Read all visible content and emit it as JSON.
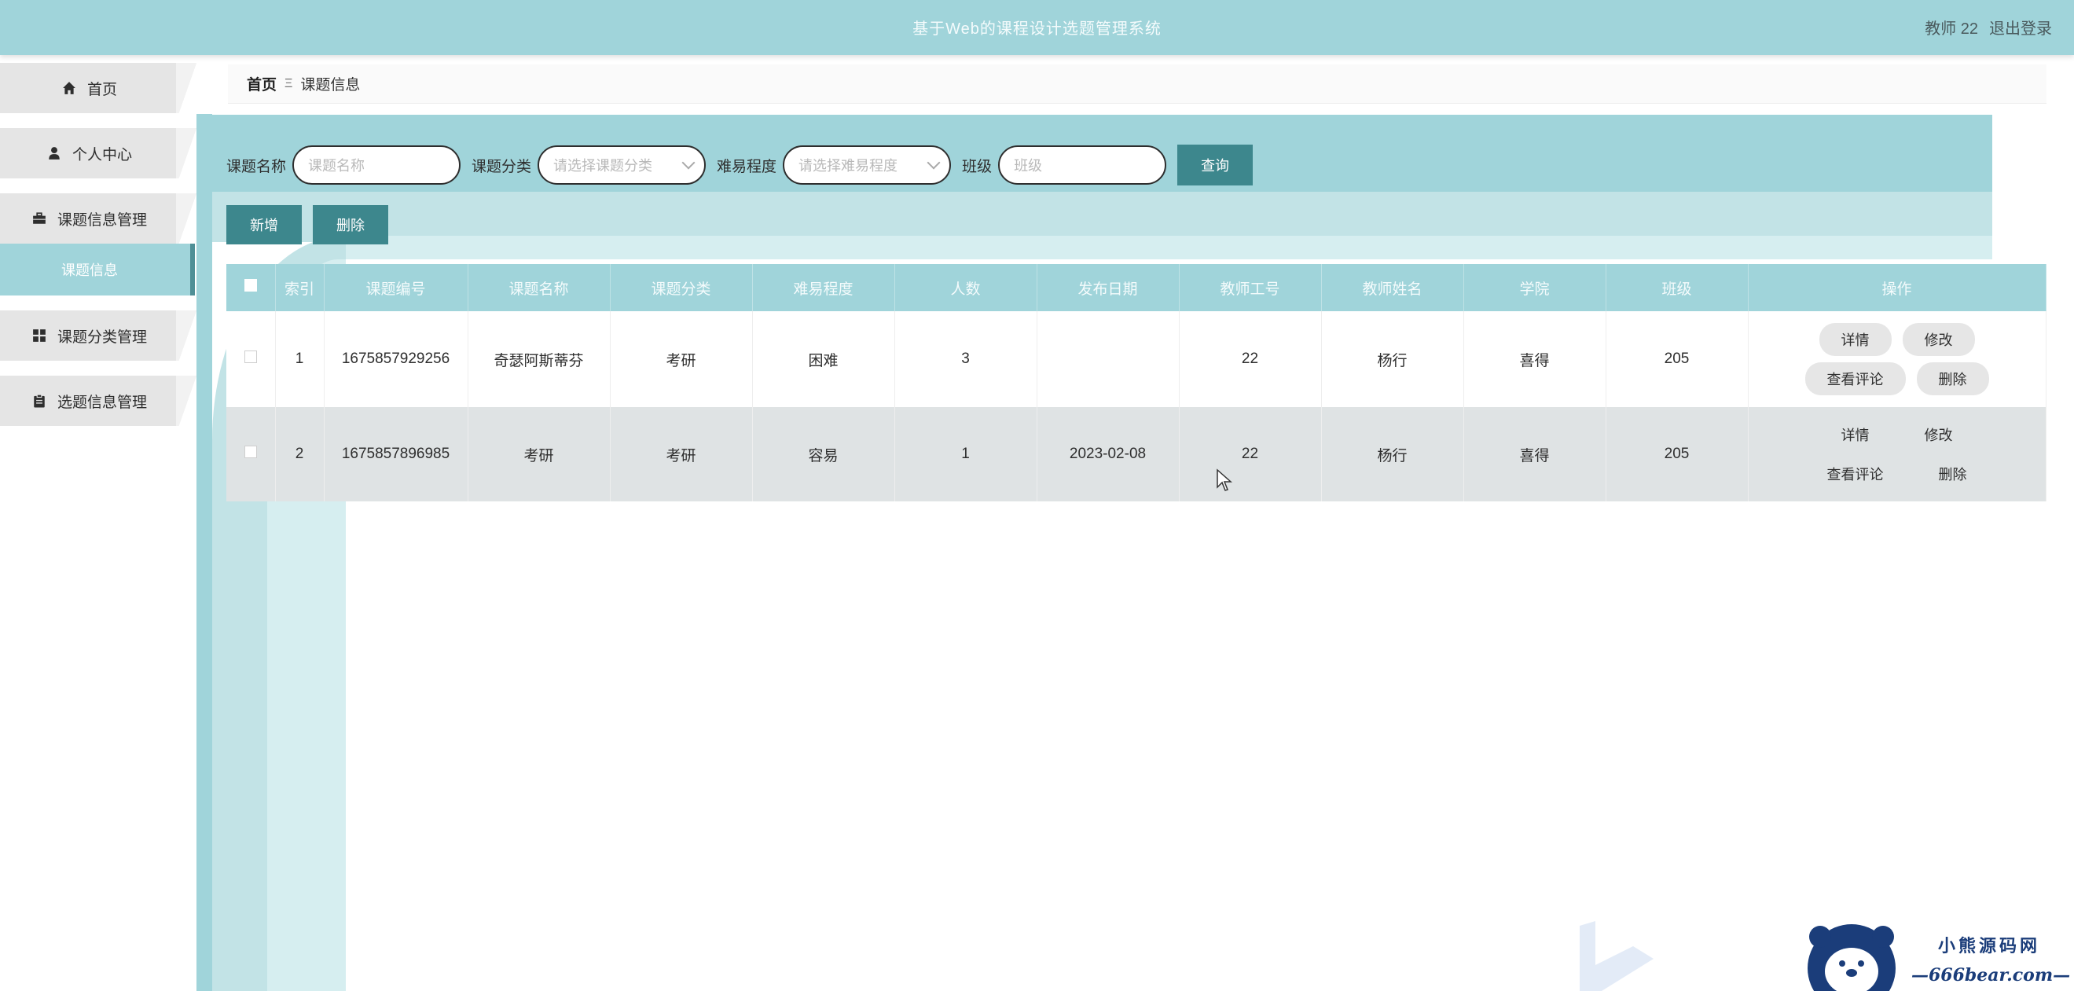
{
  "header": {
    "title": "基于Web的课程设计选题管理系统",
    "user": "教师 22",
    "logout": "退出登录"
  },
  "sidebar": {
    "items": [
      {
        "label": "首页",
        "icon": "home-icon"
      },
      {
        "label": "个人中心",
        "icon": "user-icon"
      },
      {
        "label": "课题信息管理",
        "icon": "briefcase-icon"
      },
      {
        "label": "课题分类管理",
        "icon": "grid-icon"
      },
      {
        "label": "选题信息管理",
        "icon": "clipboard-icon"
      }
    ],
    "submenu": {
      "label": "课题信息"
    }
  },
  "breadcrumb": {
    "home": "首页",
    "separator": "Ξ",
    "current": "课题信息"
  },
  "search": {
    "name_label": "课题名称",
    "name_placeholder": "课题名称",
    "category_label": "课题分类",
    "category_placeholder": "请选择课题分类",
    "difficulty_label": "难易程度",
    "difficulty_placeholder": "请选择难易程度",
    "class_label": "班级",
    "class_placeholder": "班级",
    "button": "查询"
  },
  "actions": {
    "add": "新增",
    "delete": "删除"
  },
  "table": {
    "headers": [
      "索引",
      "课题编号",
      "课题名称",
      "课题分类",
      "难易程度",
      "人数",
      "发布日期",
      "教师工号",
      "教师姓名",
      "学院",
      "班级",
      "操作"
    ],
    "rows": [
      {
        "index": "1",
        "code": "1675857929256",
        "name": "奇瑟阿斯蒂芬",
        "category": "考研",
        "difficulty": "困难",
        "count": "3",
        "date": "",
        "teacher_id": "22",
        "teacher_name": "杨行",
        "college": "喜得",
        "class": "205"
      },
      {
        "index": "2",
        "code": "1675857896985",
        "name": "考研",
        "category": "考研",
        "difficulty": "容易",
        "count": "1",
        "date": "2023-02-08",
        "teacher_id": "22",
        "teacher_name": "杨行",
        "college": "喜得",
        "class": "205"
      }
    ],
    "ops": {
      "detail": "详情",
      "edit": "修改",
      "comments": "查看评论",
      "delete": "删除"
    }
  },
  "watermark": {
    "line1": "小熊源码网",
    "line2": "—666bear.com—"
  },
  "colors": {
    "accent": "#a0d4da",
    "button": "#3d878d"
  }
}
